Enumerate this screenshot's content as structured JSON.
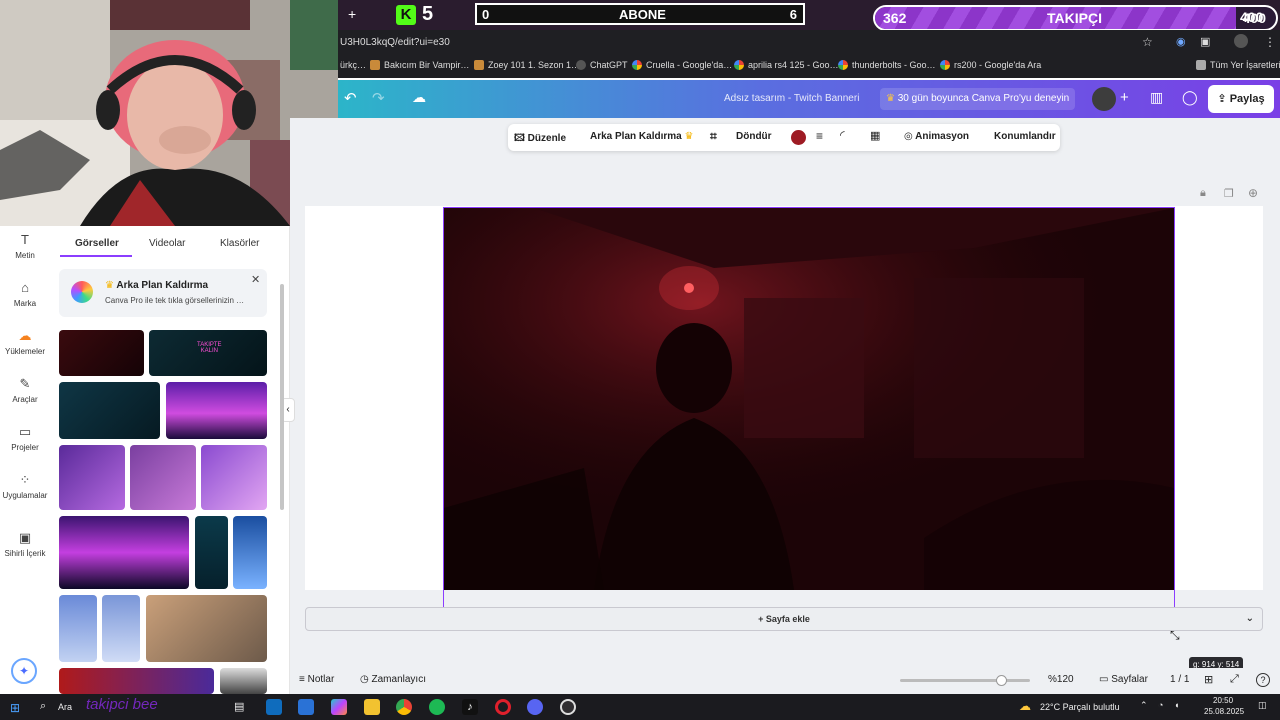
{
  "overlay": {
    "k_badge": "5",
    "abone_left": "0",
    "abone_label": "ABONE",
    "abone_right": "6",
    "takipci_count": "362",
    "takipci_label": "TAKIPÇI",
    "takipci_goal": "400",
    "takipci_progress_fraction": 0.9,
    "takipci_corner": "400"
  },
  "browser": {
    "new_tab": "+",
    "url": "U3H0L3kqQ/edit?ui=e30",
    "bookmarks": [
      "ürkç…",
      "Bakıcım Bir Vampir…",
      "Zoey 101 1. Sezon 1…",
      "ChatGPT",
      "Cruella - Google'da…",
      "aprilia rs4 125 - Goo…",
      "thunderbolts - Goo…",
      "rs200 - Google'da Ara"
    ],
    "all_bookmarks": "Tüm Yer İşaretleri"
  },
  "canva_header": {
    "title": "Adsız tasarım - Twitch Banneri",
    "pro_trial": "30 gün boyunca Canva Pro'yu deneyin",
    "share": "Paylaş"
  },
  "toolbar": {
    "edit": "Düzenle",
    "bg_remove": "Arka Plan Kaldırma",
    "rotate": "Döndür",
    "color_hex": "#9e1b24",
    "animate": "Animasyon",
    "position": "Konumlandır"
  },
  "rail": {
    "text": "Metin",
    "brand": "Marka",
    "uploads": "Yüklemeler",
    "tools": "Araçlar",
    "projects": "Projeler",
    "apps": "Uygulamalar",
    "magic": "Sihirli İçerik"
  },
  "panel": {
    "tabs": [
      "Görseller",
      "Videolar",
      "Klasörler"
    ],
    "promo_title": "Arka Plan Kaldırma",
    "promo_desc": "Canva Pro ile tek tıkla görsellerinizin …",
    "thumb_neon_text": "TAKIPTE\nKALIN"
  },
  "canvas": {
    "add_page": "+ Sayfa ekle",
    "resize_tooltip": "g: 914 y: 514"
  },
  "bottom": {
    "notes": "Notlar",
    "timer": "Zamanlayıcı",
    "zoom": "%120",
    "zoom_fraction": 0.78,
    "pages_label": "Sayfalar",
    "pages": "1 / 1"
  },
  "taskbar": {
    "search": "Ara",
    "overlay_text": "takipci bee",
    "weather": "22°C  Parçalı bulutlu",
    "time": "20:50",
    "date": "25.08.2025"
  }
}
